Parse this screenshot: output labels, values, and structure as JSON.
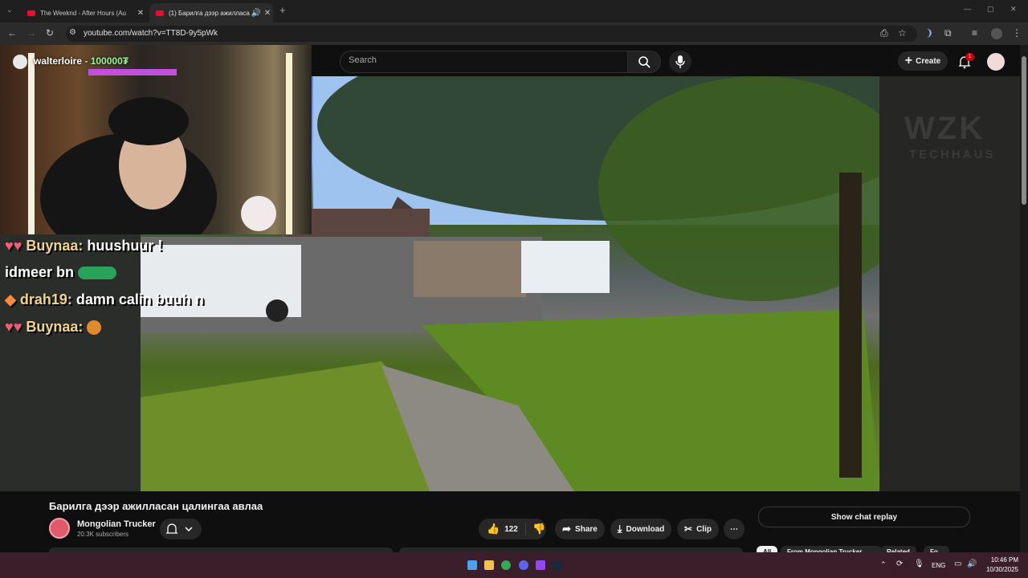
{
  "browser": {
    "tabs": [
      {
        "title": "The Weeknd - After Hours (Au"
      },
      {
        "title": "(1) Барилга дээр ажилласа"
      }
    ],
    "url": "youtube.com/watch?v=TT8D-9y5pWk"
  },
  "youtube": {
    "search_placeholder": "Search",
    "create_label": "Create",
    "notification_count": "1"
  },
  "overlay": {
    "streamer": "walterloire",
    "points": "- 100000₮",
    "chat": [
      {
        "user": "Buynaa:",
        "text": "huushuur !"
      },
      {
        "user": "",
        "text": "idmeer bn"
      },
      {
        "user": "drah19:",
        "text": "damn calin buuh n"
      },
      {
        "user": "Buynaa:",
        "text": ""
      }
    ]
  },
  "video_overlay_logo": {
    "line1": "WZK",
    "line2": "TECHHAUS"
  },
  "video": {
    "title": "Барилга дээр ажилласан цалингаа авлаа",
    "channel": "Mongolian Trucker",
    "subscribers": "20.3K subscribers",
    "likes": "122",
    "share_label": "Share",
    "download_label": "Download",
    "clip_label": "Clip"
  },
  "side": {
    "chat_replay_label": "Show chat replay",
    "chips": [
      "All",
      "From Mongolian Trucker",
      "Related",
      "Fo"
    ]
  },
  "taskbar": {
    "lang": "ENG",
    "time": "10:46 PM",
    "date": "10/30/2025"
  }
}
